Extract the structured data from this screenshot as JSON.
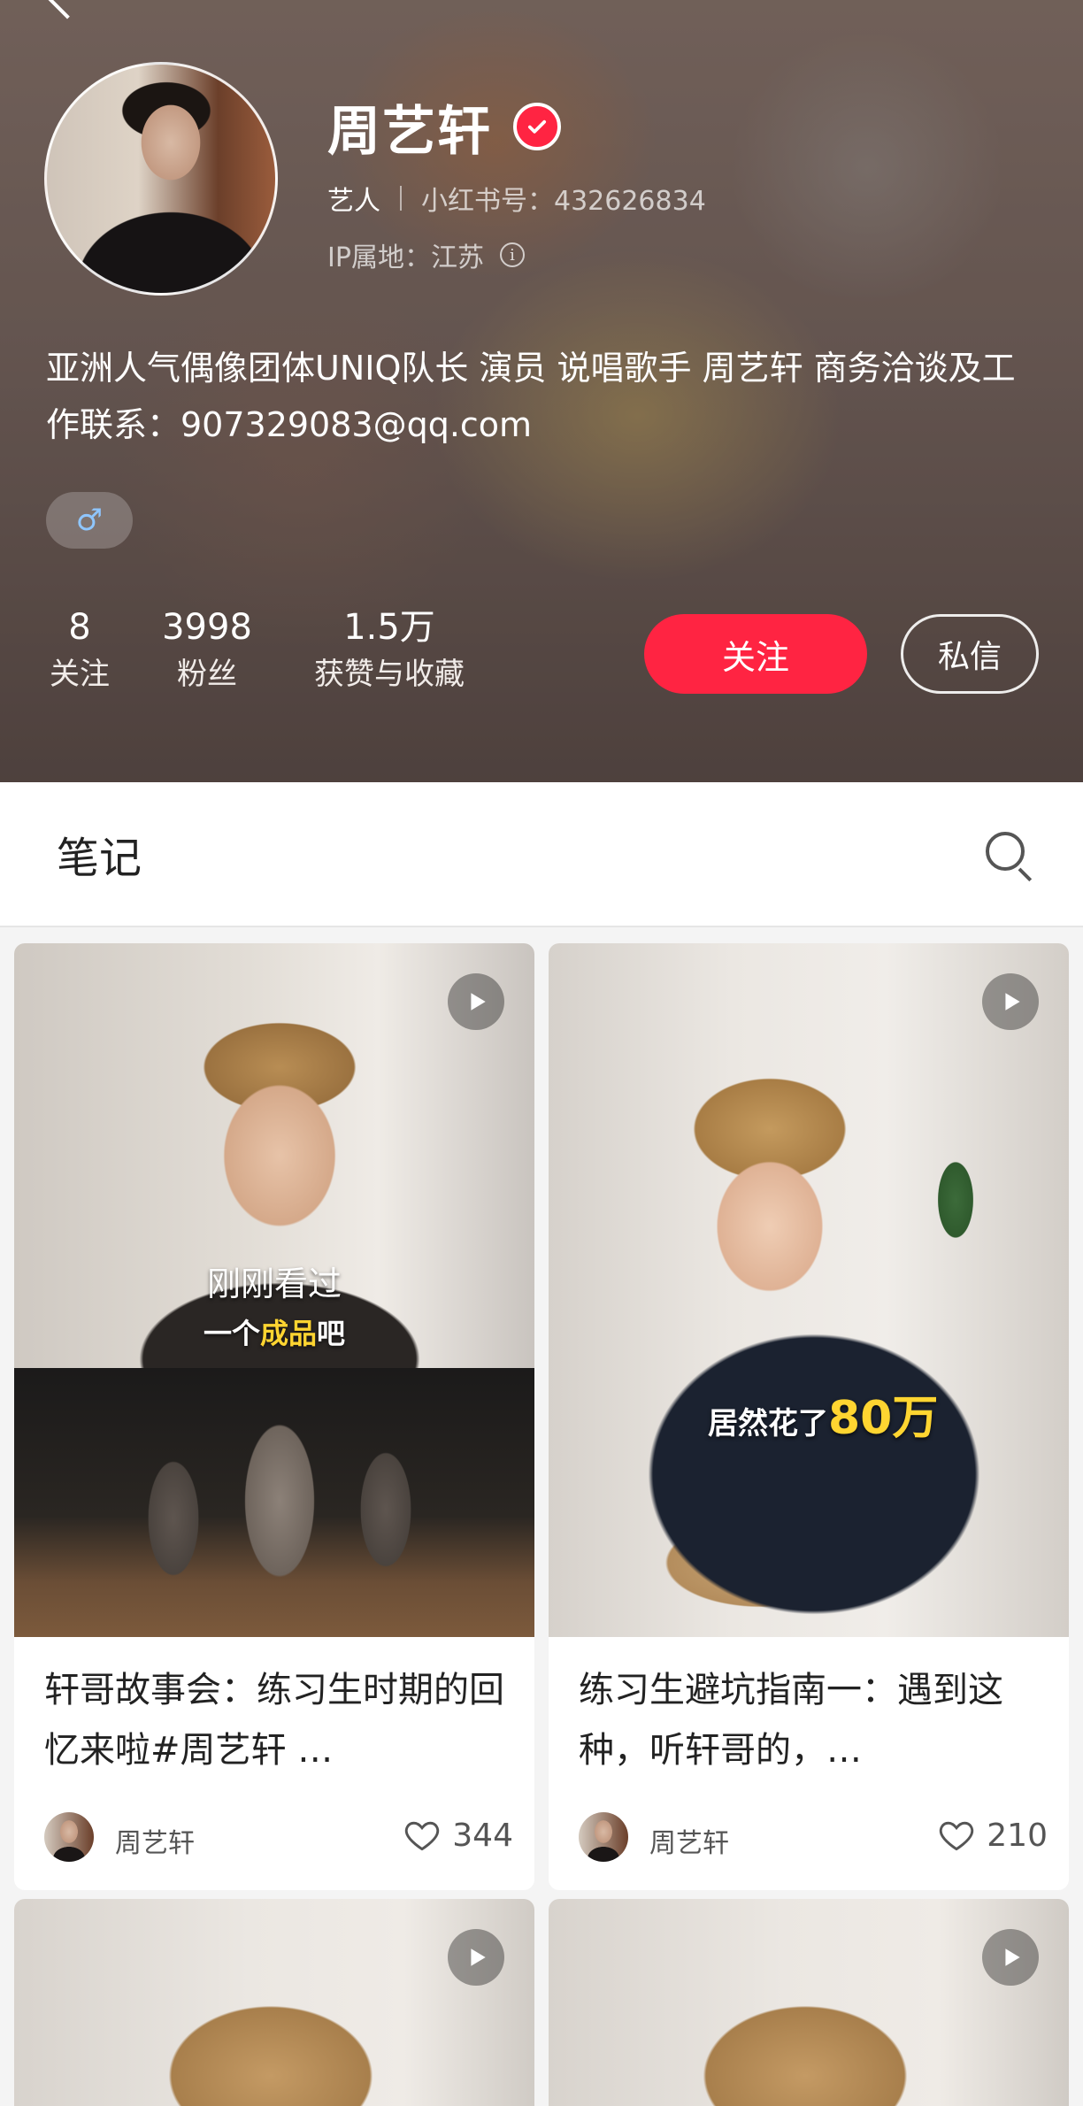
{
  "profile": {
    "name": "周艺轩",
    "role": "艺人",
    "redbook_id": "小红书号：432626834",
    "ip_location": "IP属地：江苏",
    "bio": "亚洲人气偶像团体UNIQ队长 演员 说唱歌手 周艺轩 商务洽谈及工作联系：907329083@qq.com",
    "gender_symbol": "♂",
    "stats": {
      "following": {
        "value": "8",
        "label": "关注"
      },
      "followers": {
        "value": "3998",
        "label": "粉丝"
      },
      "likes_collects": {
        "value": "1.5万",
        "label": "获赞与收藏"
      }
    },
    "follow_label": "关注",
    "message_label": "私信"
  },
  "tabs": {
    "notes_label": "笔记"
  },
  "feed": {
    "notes": [
      {
        "title": "轩哥故事会：练习生时期的回忆来啦#周艺轩 …",
        "author": "周艺轩",
        "likes": "344",
        "overlay_line1": "刚刚看过",
        "overlay_line2_prefix": "一个",
        "overlay_line2_highlight": "成品",
        "overlay_line2_suffix": "吧"
      },
      {
        "title": "练习生避坑指南一：遇到这种，听轩哥的，…",
        "author": "周艺轩",
        "likes": "210",
        "overlay_prefix": "居然花了",
        "overlay_highlight": "80万"
      }
    ]
  },
  "colors": {
    "accent": "#ff2442",
    "highlight_text": "#ffd531"
  },
  "icons": {
    "verified": "check-circle",
    "info": "info-circle",
    "search": "magnifier",
    "play": "play-triangle",
    "like": "heart-outline",
    "back": "chevron-left"
  }
}
